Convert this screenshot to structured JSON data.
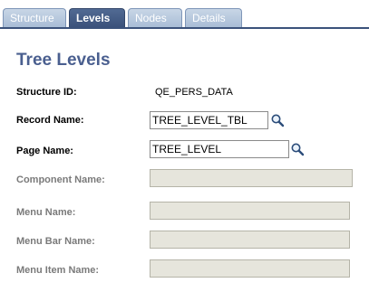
{
  "tabs": [
    {
      "label": "Structure",
      "active": false
    },
    {
      "label": "Levels",
      "active": true
    },
    {
      "label": "Nodes",
      "active": false
    },
    {
      "label": "Details",
      "active": false
    }
  ],
  "page_title": "Tree Levels",
  "fields": {
    "structure_id": {
      "label": "Structure ID:",
      "value": "QE_PERS_DATA"
    },
    "record_name": {
      "label": "Record Name:",
      "value": "TREE_LEVEL_TBL"
    },
    "page_name": {
      "label": "Page Name:",
      "value": "TREE_LEVEL"
    },
    "component_name": {
      "label": "Component Name:",
      "value": ""
    },
    "menu_name": {
      "label": "Menu Name:",
      "value": ""
    },
    "menu_bar_name": {
      "label": "Menu Bar Name:",
      "value": ""
    },
    "menu_item_name": {
      "label": "Menu Item Name:",
      "value": ""
    }
  },
  "icons": {
    "lookup": "magnifier-lookup-icon"
  },
  "colors": {
    "tab_active": "#3b527b",
    "tab_inactive": "#b7c8de",
    "title": "#4a5f8f",
    "disabled_field": "#e6e5dc"
  }
}
